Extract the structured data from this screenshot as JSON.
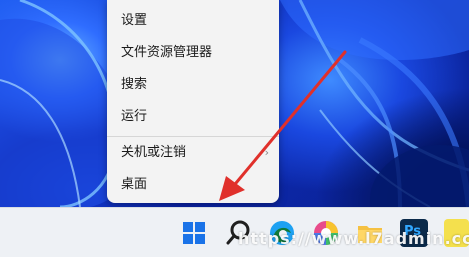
{
  "context_menu": {
    "items": [
      {
        "label": "设置"
      },
      {
        "label": "文件资源管理器"
      },
      {
        "label": "搜索"
      },
      {
        "label": "运行"
      },
      {
        "label": "关机或注销"
      },
      {
        "label": "桌面"
      }
    ],
    "submenu_caret_icon": "chevron-right-icon"
  },
  "taskbar": {
    "icons": [
      {
        "name": "start-icon",
        "color": "#1a73e8"
      },
      {
        "name": "search-icon",
        "color": "#202020"
      },
      {
        "name": "edge-icon",
        "color": "#1da1f2"
      },
      {
        "name": "color-wheel-app-icon",
        "color": "#e84c8b"
      },
      {
        "name": "file-explorer-icon",
        "color": "#f5c142"
      },
      {
        "name": "photoshop-icon",
        "color": "#0b2a4a"
      },
      {
        "name": "notes-app-icon",
        "color": "#f4e04d"
      }
    ],
    "photoshop_label": "Ps"
  },
  "annotation": {
    "arrow_color": "#e0302b"
  },
  "watermark": {
    "text": "https://www.l7admin.cc"
  }
}
